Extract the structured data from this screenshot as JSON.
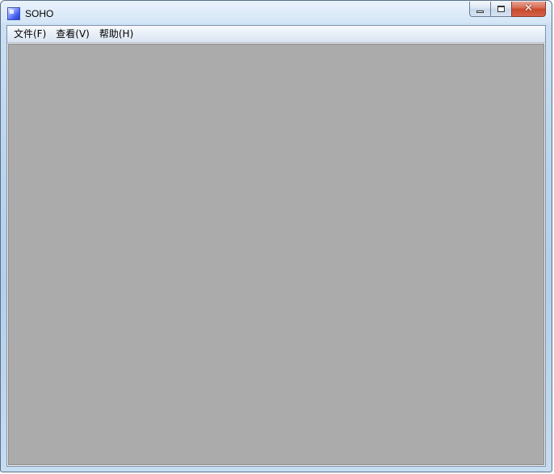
{
  "window": {
    "title": "SOHO"
  },
  "menu": {
    "items": [
      {
        "label": "文件(F)"
      },
      {
        "label": "查看(V)"
      },
      {
        "label": "帮助(H)"
      }
    ]
  },
  "icons": {
    "app": "app-icon",
    "minimize": "minimize-icon",
    "maximize": "maximize-icon",
    "close": "close-icon"
  },
  "colors": {
    "workspace": "#ababab",
    "close_button": "#c74a2b",
    "frame": "#b3cfea"
  }
}
